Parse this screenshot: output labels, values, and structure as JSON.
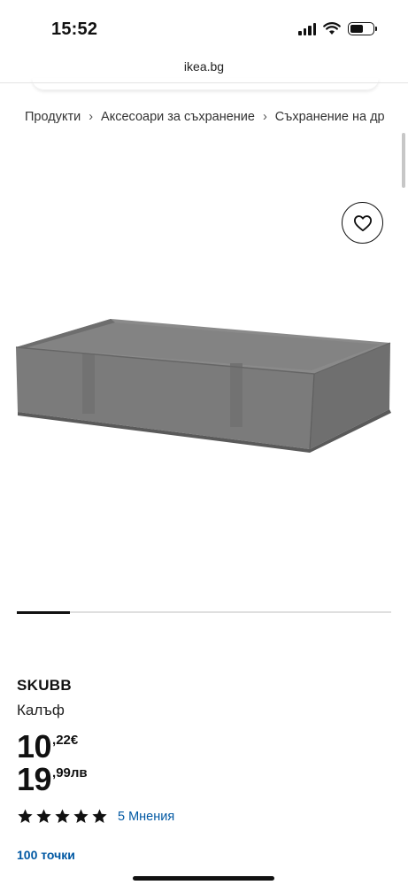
{
  "status_bar": {
    "time": "15:52",
    "battery_level": 0.6
  },
  "browser": {
    "url": "ikea.bg"
  },
  "breadcrumb": {
    "items": [
      "Продукти",
      "Аксесоари за съхранение",
      "Съхранение на др"
    ],
    "separator": "›"
  },
  "gallery": {
    "image_count": 7,
    "active_index": 0
  },
  "product": {
    "name": "SKUBB",
    "description": "Калъф",
    "price_eur": {
      "integer": "10",
      "decimal": ",22€"
    },
    "price_bgn": {
      "integer": "19",
      "decimal": ",99лв"
    },
    "rating": {
      "stars": 5,
      "max": 5,
      "reviews_label": "5 Мнения"
    },
    "points_label": "100 точки"
  },
  "colors": {
    "accent_link": "#0058a3",
    "text": "#111111",
    "divider": "#dfdfdf"
  },
  "icons": [
    "signal-icon",
    "wifi-icon",
    "battery-icon",
    "heart-icon",
    "star-icon"
  ]
}
